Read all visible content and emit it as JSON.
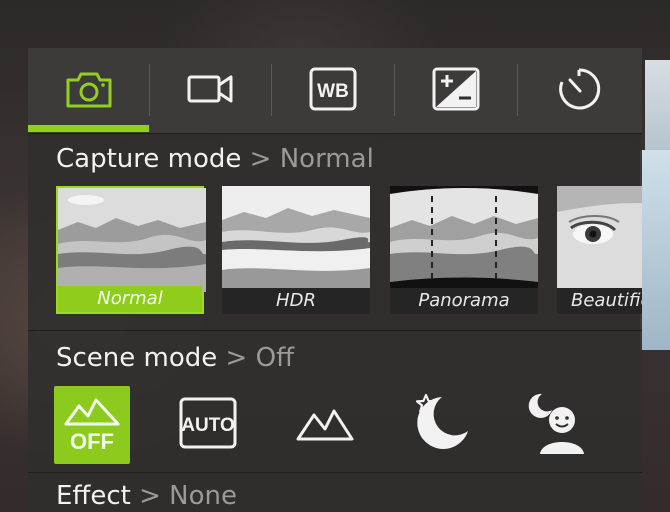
{
  "tabs": [
    {
      "icon": "camera-icon",
      "selected": true
    },
    {
      "icon": "video-icon",
      "selected": false
    },
    {
      "icon": "white-balance-icon",
      "label": "WB",
      "selected": false
    },
    {
      "icon": "exposure-icon",
      "selected": false
    },
    {
      "icon": "timer-icon",
      "selected": false
    }
  ],
  "capture_mode": {
    "title": "Capture mode",
    "separator": ">",
    "value": "Normal",
    "options": [
      {
        "label": "Normal",
        "selected": true
      },
      {
        "label": "HDR",
        "selected": false
      },
      {
        "label": "Panorama",
        "selected": false
      },
      {
        "label": "Beautification",
        "selected": false
      }
    ]
  },
  "scene_mode": {
    "title": "Scene mode",
    "separator": ">",
    "value": "Off",
    "options": [
      {
        "icon": "scene-off-icon",
        "label": "OFF",
        "selected": true
      },
      {
        "icon": "scene-auto-icon",
        "label": "AUTO",
        "selected": false
      },
      {
        "icon": "landscape-icon",
        "selected": false
      },
      {
        "icon": "night-icon",
        "selected": false
      },
      {
        "icon": "night-portrait-icon",
        "selected": false
      }
    ]
  },
  "effect": {
    "title": "Effect",
    "separator": ">",
    "value": "None"
  },
  "colors": {
    "accent": "#8fd11e",
    "panel": "#302e2d",
    "muted_text": "#9c9a98"
  }
}
